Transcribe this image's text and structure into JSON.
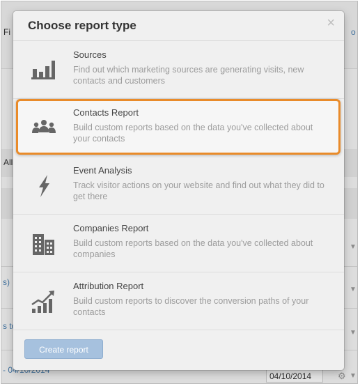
{
  "background": {
    "fragments": [
      "Fi",
      "o",
      "All",
      "s)",
      "s to",
      "- 04/10/2014"
    ],
    "date_value": "04/10/2014"
  },
  "modal": {
    "title": "Choose report type",
    "close_glyph": "×",
    "options": [
      {
        "icon": "bar-chart-icon",
        "title": "Sources",
        "description": "Find out which marketing sources are generating visits, new contacts and customers"
      },
      {
        "icon": "people-icon",
        "title": "Contacts Report",
        "description": "Build custom reports based on the data you've collected about your contacts"
      },
      {
        "icon": "lightning-icon",
        "title": "Event Analysis",
        "description": "Track visitor actions on your website and find out what they did to get there"
      },
      {
        "icon": "building-icon",
        "title": "Companies Report",
        "description": "Build custom reports based on the data you've collected about companies"
      },
      {
        "icon": "trend-chart-icon",
        "title": "Attribution Report",
        "description": "Build custom reports to discover the conversion paths of your contacts"
      }
    ],
    "create_button": "Create report"
  },
  "colors": {
    "highlight": "#e98b2a",
    "button": "#a6c1de",
    "icon": "#666666"
  }
}
